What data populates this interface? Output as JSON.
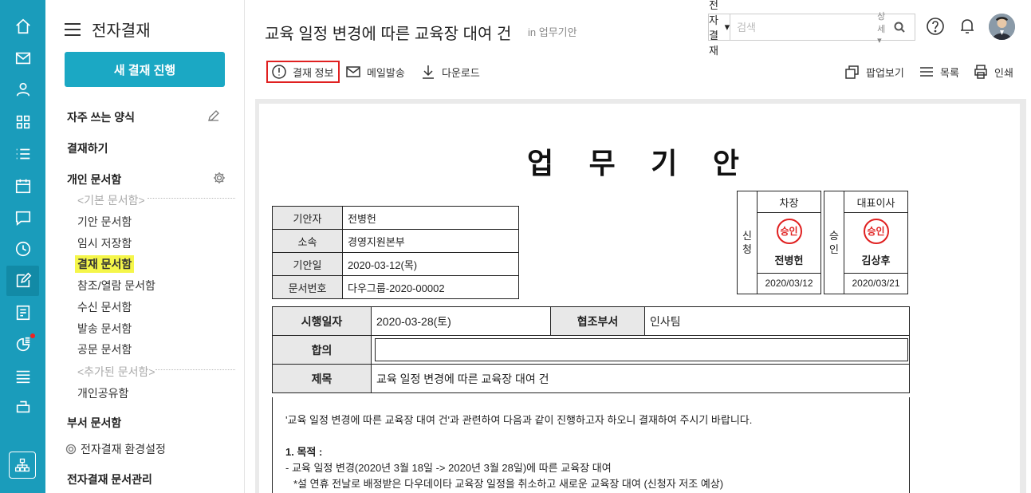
{
  "sidebar": {
    "title": "전자결재",
    "new_button": "새 결재 진행",
    "favorites": "자주 쓰는 양식",
    "approve": "결재하기",
    "personal": "개인 문서함",
    "basic_cat": "<기본 문서함>",
    "items": [
      "기안 문서함",
      "임시 저장함",
      "결재 문서함",
      "참조/열람 문서함",
      "수신 문서함",
      "발송 문서함",
      "공문 문서함"
    ],
    "added_cat": "<추가된 문서함>",
    "shared": "개인공유함",
    "dept": "부서 문서함",
    "settings": "전자결재 환경설정",
    "manage": "전자결재 문서관리"
  },
  "header": {
    "title": "교육 일정 변경에 따른 교육장 대여 건",
    "sub": "in 업무기안",
    "search_select": "전자결재",
    "search_placeholder": "검색",
    "search_adv": "상세"
  },
  "toolbar": {
    "info": "결재 정보",
    "mail": "메일발송",
    "download": "다운로드",
    "popup": "팝업보기",
    "list": "목록",
    "print": "인쇄"
  },
  "doc": {
    "title": "업 무 기 안",
    "info": [
      {
        "k": "기안자",
        "v": "전병헌"
      },
      {
        "k": "소속",
        "v": "경영지원본부"
      },
      {
        "k": "기안일",
        "v": "2020-03-12(목)"
      },
      {
        "k": "문서번호",
        "v": "다우그룹-2020-00002"
      }
    ],
    "approval": {
      "apply_label": "신\n청",
      "approve_label": "승\n인",
      "apply": {
        "role": "차장",
        "stamp": "승인",
        "name": "전병헌",
        "date": "2020/03/12"
      },
      "approve": {
        "role": "대표이사",
        "stamp": "승인",
        "name": "김상후",
        "date": "2020/03/21"
      }
    },
    "exec_label": "시행일자",
    "exec_date": "2020-03-28(토)",
    "coop_label": "협조부서",
    "coop_dept": "인사팀",
    "agree_label": "합의",
    "subject_label": "제목",
    "subject": "교육 일정 변경에 따른 교육장 대여 건",
    "body": {
      "intro": "'교육 일정 변경에 따른 교육장 대여 건'과 관련하여 다음과 같이 진행하고자 하오니 결재하여 주시기 바랍니다.",
      "heading": "1. 목적 :",
      "line1": "- 교육 일정 변경(2020년 3월 18일 -> 2020년 3월 28일)에 따른 교육장 대여",
      "line2": "*설 연휴 전날로 배정받은 다우데이타 교육장 일정을 취소하고 새로운 교육장 대여 (신청자 저조 예상)"
    }
  }
}
